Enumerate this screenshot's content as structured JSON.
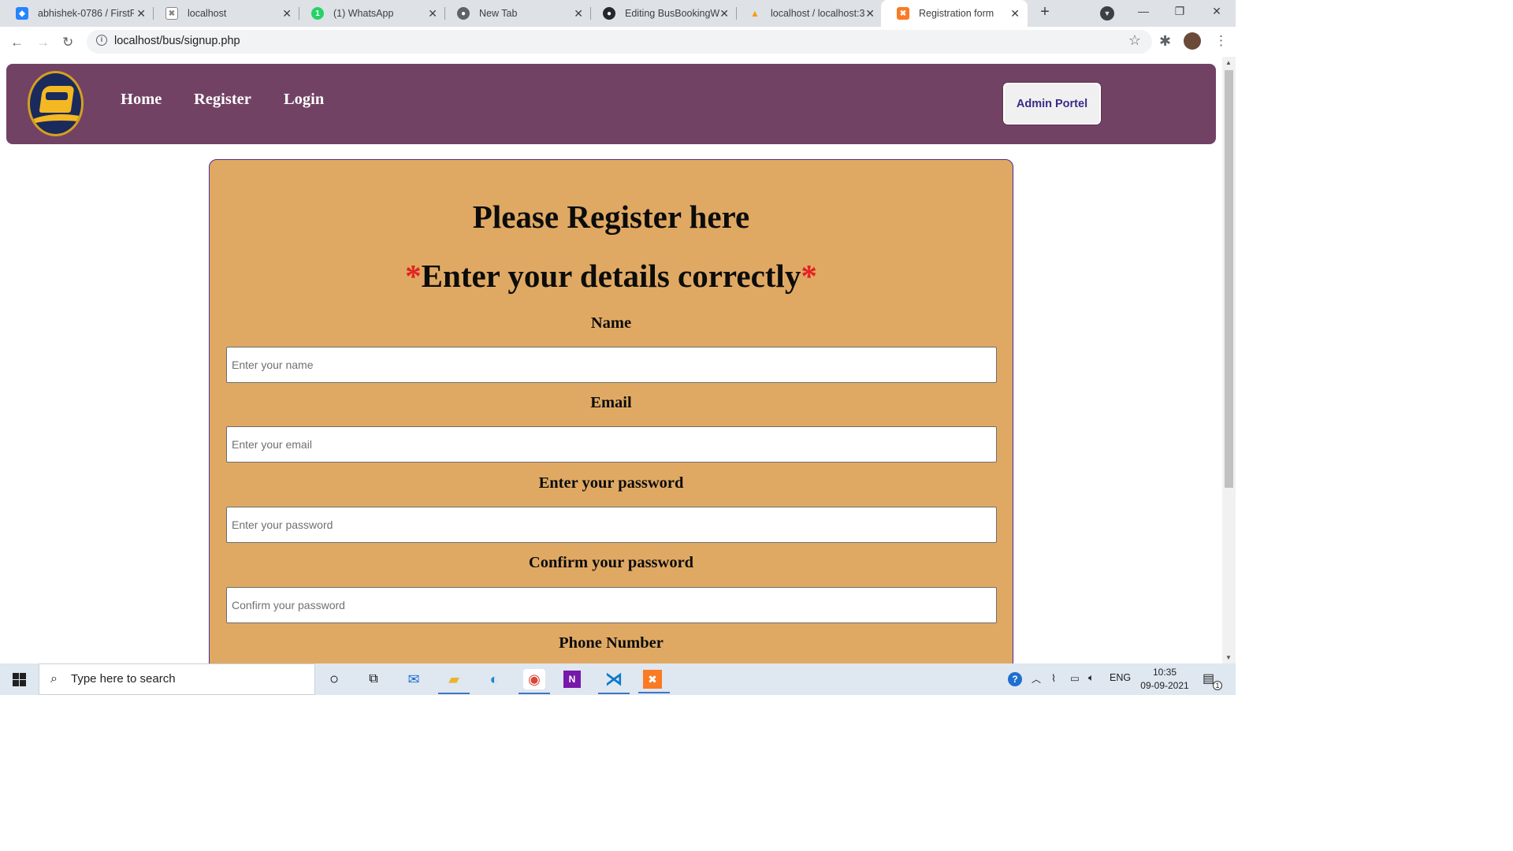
{
  "browser": {
    "tabs": [
      {
        "title": "abhishek-0786 / FirstR",
        "favicon": "bitbucket-icon",
        "color": "#2684ff"
      },
      {
        "title": "localhost",
        "favicon": "xampp-icon",
        "color": "#888888"
      },
      {
        "title": "(1) WhatsApp",
        "favicon": "whatsapp-icon",
        "color": "#25d366"
      },
      {
        "title": "New Tab",
        "favicon": "chrome-icon",
        "color": "#5f6368"
      },
      {
        "title": "Editing BusBookingW",
        "favicon": "github-icon",
        "color": "#24292e"
      },
      {
        "title": "localhost / localhost:3",
        "favicon": "phpmyadmin-icon",
        "color": "#f89c0e"
      },
      {
        "title": "Registration form",
        "favicon": "xampp-icon",
        "color": "#fb7a24"
      }
    ],
    "new_tab_symbol": "+",
    "url": "localhost/bus/signup.php"
  },
  "site": {
    "nav": {
      "home": "Home",
      "register": "Register",
      "login": "Login",
      "admin_button": "Admin Portel"
    },
    "heading": "Please Register here",
    "subheading": "Enter your details correctly",
    "required_mark": "*",
    "fields": [
      {
        "label": "Name",
        "placeholder": "Enter your name",
        "value": ""
      },
      {
        "label": "Email",
        "placeholder": "Enter your email",
        "value": ""
      },
      {
        "label": "Enter your password",
        "placeholder": "Enter your password",
        "value": ""
      },
      {
        "label": "Confirm your password",
        "placeholder": "Confirm your password",
        "value": ""
      },
      {
        "label": "Phone Number"
      }
    ],
    "colors": {
      "navbar": "#724264",
      "card": "#e0a963",
      "admin_text": "#3c2a87",
      "required": "#e22222"
    }
  },
  "taskbar": {
    "search_placeholder": "Type here to search",
    "apps": [
      "cortana-icon",
      "task-view-icon",
      "mail-icon",
      "file-explorer-icon",
      "edge-icon",
      "chrome-icon",
      "onenote-icon",
      "vscode-icon",
      "xampp-icon"
    ],
    "language": "ENG",
    "time": "10:35",
    "date": "09-09-2021",
    "notification_count": "1"
  }
}
